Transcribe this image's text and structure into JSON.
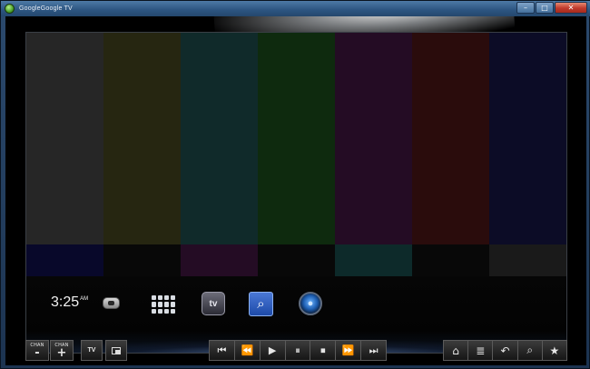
{
  "window": {
    "title": "GoogleGoogle TV",
    "minimize_icon": "minimize-icon",
    "maximize_icon": "maximize-icon",
    "close_icon": "close-icon",
    "min_glyph": "–",
    "max_glyph": "□",
    "close_glyph": "✕"
  },
  "test_pattern": {
    "bars": [
      "#262626",
      "#262611",
      "#102a2a",
      "#0e2a0e",
      "#240c24",
      "#2a0c0c",
      "#0c0c26"
    ],
    "lower_bars": [
      "#08082a",
      "#080808",
      "#240c24",
      "#080808",
      "#0d2a2a",
      "#080808",
      "#1a1a1a"
    ]
  },
  "overlay": {
    "time": "3:25",
    "ampm": "AM",
    "icons": [
      "chat-bubble-icon",
      "app-grid-icon",
      "tv-icon",
      "search-icon",
      "orb-icon"
    ],
    "tv_glyph": "tv",
    "search_glyph": "⌕",
    "orb_glyph": "●"
  },
  "controls": {
    "chan_down_label": "CHAN",
    "chan_down_glyph": "-",
    "chan_up_label": "CHAN",
    "chan_up_glyph": "+",
    "tv_label": "TV",
    "transport": [
      "⏮",
      "⏪",
      "▶",
      "⏸",
      "⏹",
      "⏩",
      "⏭"
    ],
    "nav": [
      "⌂",
      "≣",
      "↶",
      "⌕",
      "★"
    ]
  },
  "colors": {
    "accent": "#2c5480",
    "close_button": "#c0392b"
  }
}
